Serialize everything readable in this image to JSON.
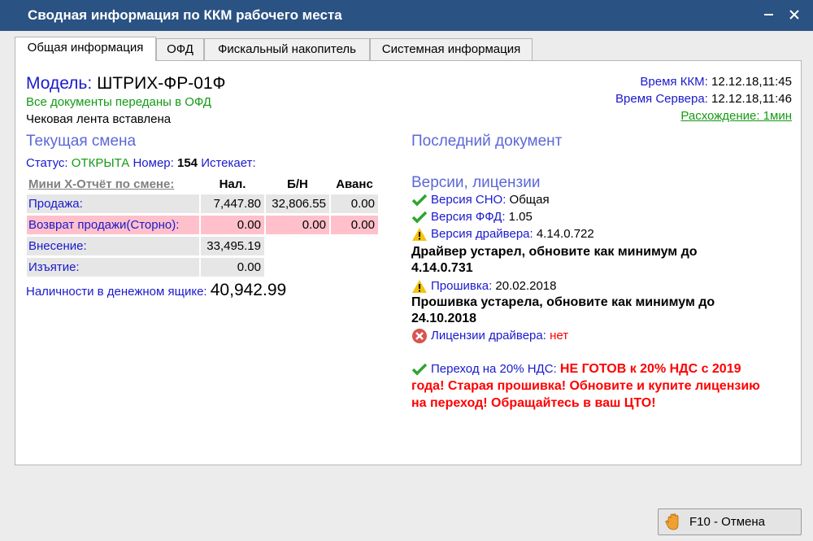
{
  "window": {
    "title": "Сводная информация по ККМ рабочего места"
  },
  "tabs": [
    "Общая информация",
    "ОФД",
    "Фискальный накопитель",
    "Системная информация"
  ],
  "device": {
    "model_label": "Модель:",
    "model_value": "ШТРИХ-ФР-01Ф",
    "ofd_status": "Все документы переданы в ОФД",
    "tape_status": "Чековая лента вставлена"
  },
  "time": {
    "kkm_label": "Время ККМ:",
    "kkm_value": "12.12.18,11:45",
    "server_label": "Время Сервера:",
    "server_value": "12.12.18,11:46",
    "diff": "Расхождение: 1мин"
  },
  "shift": {
    "heading": "Текущая смена",
    "status_label": "Статус:",
    "status_value": "ОТКРЫТА",
    "number_label": "Номер:",
    "number_value": "154",
    "expires_label": "Истекает:"
  },
  "report": {
    "title": "Мини Х-Отчёт по смене:",
    "columns": [
      "Нал.",
      "Б/Н",
      "Аванс"
    ],
    "rows": [
      {
        "label": "Продажа:",
        "cash": "7,447.80",
        "card": "32,806.55",
        "advance": "0.00"
      },
      {
        "label": "Возврат продажи(Сторно):",
        "cash": "0.00",
        "card": "0.00",
        "advance": "0.00"
      },
      {
        "label": "Внесение:",
        "cash": "33,495.19"
      },
      {
        "label": "Изъятие:",
        "cash": "0.00"
      }
    ],
    "cashbox_label": "Наличности в денежном ящике:",
    "cashbox_value": "40,942.99"
  },
  "last_doc": {
    "heading": "Последний документ"
  },
  "versions": {
    "heading": "Версии, лицензии",
    "sno_label": "Версия СНО:",
    "sno_value": "Общая",
    "ffd_label": "Версия ФФД:",
    "ffd_value": "1.05",
    "driver_label": "Версия драйвера:",
    "driver_value": "4.14.0.722",
    "driver_warning_line1": "Драйвер устарел, обновите как минимум до",
    "driver_warning_line2": "4.14.0.731",
    "firmware_label": "Прошивка:",
    "firmware_value": "20.02.2018",
    "firmware_warning_line1": "Прошивка устарела, обновите как минимум до",
    "firmware_warning_line2": "24.10.2018",
    "license_label": "Лицензии драйвера:",
    "license_value": "нет",
    "vat_label": "Переход на 20% НДС:",
    "vat_line1": "НЕ ГОТОВ к 20% НДС с 2019",
    "vat_line2": "года! Старая прошивка! Обновите и купите лицензию",
    "vat_line3": "на переход! Обращайтесь в ваш ЦТО!"
  },
  "footer": {
    "cancel_label": "F10 - Отмена"
  },
  "colors": {
    "titlebar": "#2a5283",
    "label_blue": "#1a1acd",
    "heading_blue": "#5c67d8",
    "status_green": "#139a13",
    "error_red": "#ff0000",
    "row_pink": "#ffc0cb",
    "row_gray": "#e6e6e6"
  }
}
